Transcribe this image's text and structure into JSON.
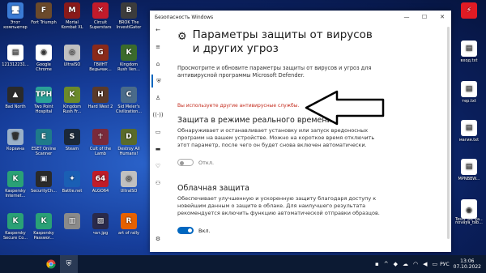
{
  "desktop_icons_left": [
    {
      "label": "Этот компьютер",
      "color": "#3a7bd5",
      "glyph": "🖥"
    },
    {
      "label": "Fort Triumph",
      "color": "#6b4a2b",
      "glyph": "F"
    },
    {
      "label": "Mortal Kombat XL",
      "color": "#8a1a1a",
      "glyph": "M"
    },
    {
      "label": "Circuit Superstars",
      "color": "#c21b2b",
      "glyph": "✕"
    },
    {
      "label": "BROK The InvestiGator",
      "color": "#3c3c3c",
      "glyph": "B"
    },
    {
      "label": "121312231...",
      "color": "#ffffff",
      "glyph": "▤"
    },
    {
      "label": "Google Chrome",
      "color": "#ffffff",
      "glyph": "◉"
    },
    {
      "label": "UltraISO",
      "color": "#c0c0c0",
      "glyph": "◎"
    },
    {
      "label": "ГВИНТ Ведьмак...",
      "color": "#8a2a1a",
      "glyph": "G"
    },
    {
      "label": "Kingdom Rush Ven...",
      "color": "#3b6b2b",
      "glyph": "K"
    },
    {
      "label": "Bad North",
      "color": "#2a2a2a",
      "glyph": "▲"
    },
    {
      "label": "Two Point Hospital",
      "color": "#2aa198",
      "glyph": "TPH"
    },
    {
      "label": "Kingdom Rush Fr...",
      "color": "#6b8a2b",
      "glyph": "K"
    },
    {
      "label": "Hard West 2",
      "color": "#5a3a2a",
      "glyph": "H"
    },
    {
      "label": "Sid Meier's Civilization...",
      "color": "#4a6b8a",
      "glyph": "C"
    },
    {
      "label": "Корзина",
      "color": "#9ab0c8",
      "glyph": "🗑"
    },
    {
      "label": "ESET Online Scanner",
      "color": "#1f7a8a",
      "glyph": "E"
    },
    {
      "label": "Steam",
      "color": "#1b2838",
      "glyph": "S"
    },
    {
      "label": "Cult of the Lamb",
      "color": "#7a2a3a",
      "glyph": "☥"
    },
    {
      "label": "Destroy All Humans!",
      "color": "#5a6b2a",
      "glyph": "D"
    },
    {
      "label": "Kaspersky Internet...",
      "color": "#2aa176",
      "glyph": "K"
    },
    {
      "label": "SecurityCh...",
      "color": "#2a2a2a",
      "glyph": "▣"
    },
    {
      "label": "Battle.net",
      "color": "#1a5fb4",
      "glyph": "✦"
    },
    {
      "label": "ALGO64",
      "color": "#c01c28",
      "glyph": "64"
    },
    {
      "label": "UltraISO",
      "color": "#c0c0c0",
      "glyph": "◎"
    },
    {
      "label": "Kaspersky Secure Co...",
      "color": "#2aa176",
      "glyph": "K"
    },
    {
      "label": "Kaspersky Passwor...",
      "color": "#2aa176",
      "glyph": "K"
    },
    {
      "label": "",
      "color": "#8a8a8a",
      "glyph": "▥"
    },
    {
      "label": "чат.jpg",
      "color": "#2a2a4a",
      "glyph": "▨"
    },
    {
      "label": "art of rally",
      "color": "#e66100",
      "glyph": "R"
    }
  ],
  "desktop_icons_right": [
    {
      "label": "",
      "color": "#e01b24",
      "glyph": "⚡"
    },
    {
      "label": "вход.txt",
      "color": "#ffffff",
      "glyph": "▤"
    },
    {
      "label": "тер.txt",
      "color": "#ffffff",
      "glyph": "▤"
    },
    {
      "label": "магия.txt",
      "color": "#ffffff",
      "glyph": "▤"
    },
    {
      "label": "MPNBBW...",
      "color": "#ffffff",
      "glyph": "▤"
    },
    {
      "label": "Testy_po_ya...",
      "color": "#ffffff",
      "glyph": "◉"
    },
    {
      "label": "novaya_tab...",
      "color": "#ffffff",
      "glyph": "◉"
    }
  ],
  "window": {
    "title": "Безопасность Windows",
    "minimize": "—",
    "maximize": "☐",
    "close": "✕"
  },
  "rail_icons": [
    "back-icon",
    "menu-icon",
    "home-icon",
    "shield-icon",
    "person-icon",
    "wifi-icon",
    "app-icon",
    "laptop-icon",
    "heart-icon",
    "family-icon",
    "settings-icon"
  ],
  "page": {
    "title": "Параметры защиты от вирусов и других угроз",
    "description": "Просмотрите и обновите параметры защиты от вирусов и угроз для антивирусной программы Microsoft Defender.",
    "warning": "Вы используете другие антивирусные службы.",
    "realtime": {
      "title": "Защита в режиме реального времени",
      "description": "Обнаруживает и останавливает установку или запуск вредоносных программ на вашем устройстве. Можно на короткое время отключить этот параметр, после чего он будет снова включен автоматически.",
      "toggle_label": "Откл.",
      "enabled": false
    },
    "cloud": {
      "title": "Облачная защита",
      "description": "Обеспечивает улучшенную и ускоренную защиту благодаря доступу к новейшим данным о защите в облаке. Для наилучшего результата рекомендуется включить функцию автоматической отправки образцов.",
      "toggle_label": "Вкл.",
      "enabled": true
    }
  },
  "taskbar": {
    "language": "РУС",
    "time": "13:06",
    "date": "07.10.2022"
  },
  "colors": {
    "accent": "#0067c0",
    "warning": "#c42b1c"
  }
}
